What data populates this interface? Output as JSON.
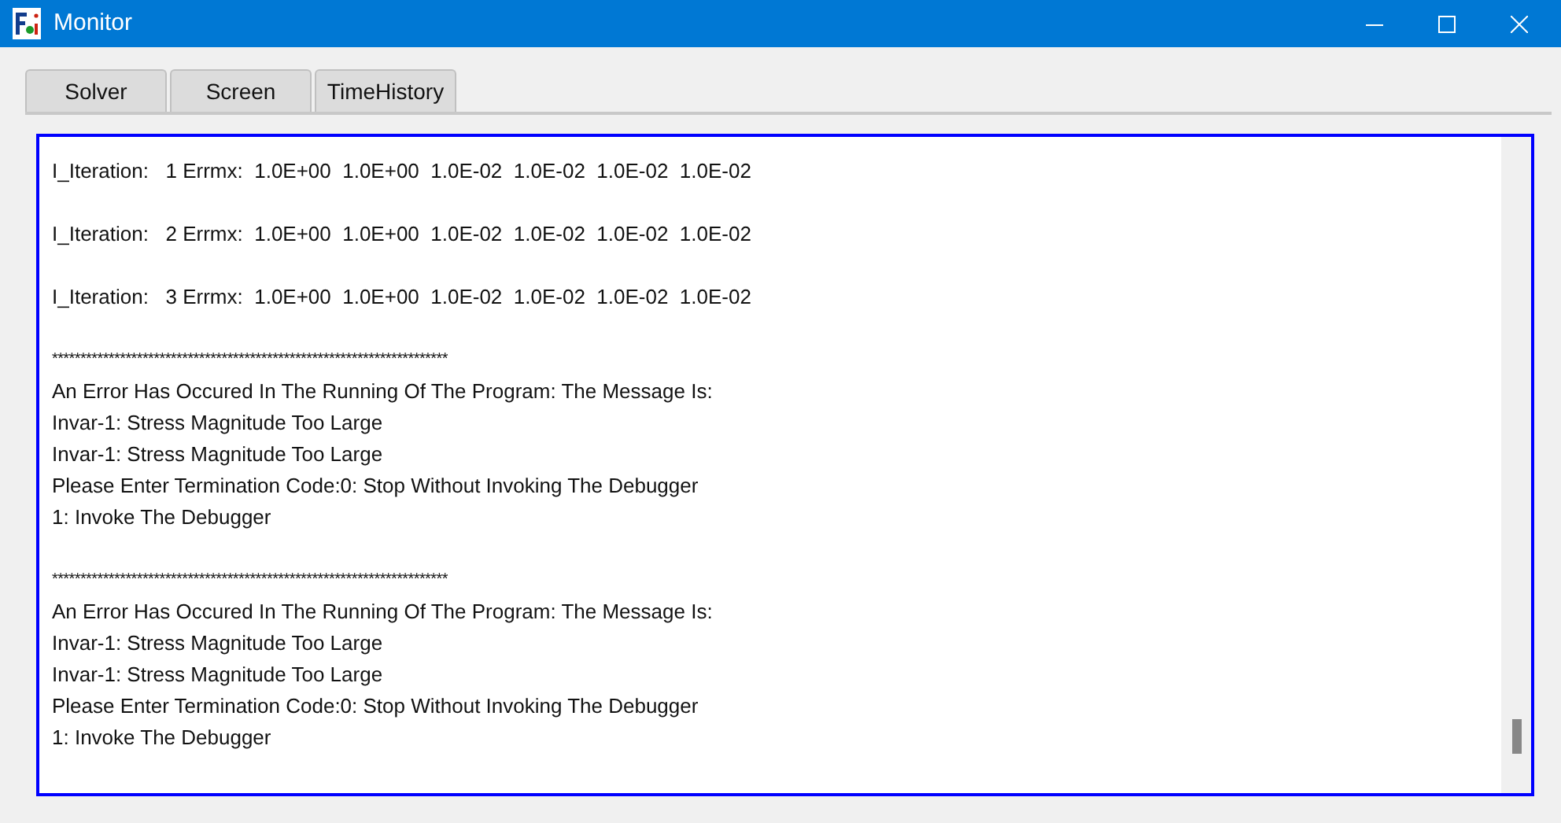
{
  "window": {
    "title": "Monitor"
  },
  "tabs": [
    {
      "label": "Solver",
      "selected": false
    },
    {
      "label": "Screen",
      "selected": false
    },
    {
      "label": "TimeHistory",
      "selected": false
    }
  ],
  "console": {
    "lines": [
      {
        "kind": "text",
        "text": "I_Iteration:   1 Errmx:  1.0E+00  1.0E+00  1.0E-02  1.0E-02  1.0E-02  1.0E-02"
      },
      {
        "kind": "blank"
      },
      {
        "kind": "text",
        "text": "I_Iteration:   2 Errmx:  1.0E+00  1.0E+00  1.0E-02  1.0E-02  1.0E-02  1.0E-02"
      },
      {
        "kind": "blank"
      },
      {
        "kind": "text",
        "text": "I_Iteration:   3 Errmx:  1.0E+00  1.0E+00  1.0E-02  1.0E-02  1.0E-02  1.0E-02"
      },
      {
        "kind": "blank"
      },
      {
        "kind": "separator",
        "text": "**********************************************************************"
      },
      {
        "kind": "text",
        "text": "An Error Has Occured In The Running Of The Program: The Message Is:"
      },
      {
        "kind": "text",
        "text": "Invar-1: Stress Magnitude Too Large"
      },
      {
        "kind": "text",
        "text": "Invar-1: Stress Magnitude Too Large"
      },
      {
        "kind": "text",
        "text": "Please Enter Termination Code:0: Stop Without Invoking The Debugger"
      },
      {
        "kind": "text",
        "text": "1: Invoke The Debugger"
      },
      {
        "kind": "blank"
      },
      {
        "kind": "separator",
        "text": "**********************************************************************"
      },
      {
        "kind": "text",
        "text": "An Error Has Occured In The Running Of The Program: The Message Is:"
      },
      {
        "kind": "text",
        "text": "Invar-1: Stress Magnitude Too Large"
      },
      {
        "kind": "text",
        "text": "Invar-1: Stress Magnitude Too Large"
      },
      {
        "kind": "text",
        "text": "Please Enter Termination Code:0: Stop Without Invoking The Debugger"
      },
      {
        "kind": "text",
        "text": "1: Invoke The Debugger"
      }
    ]
  }
}
